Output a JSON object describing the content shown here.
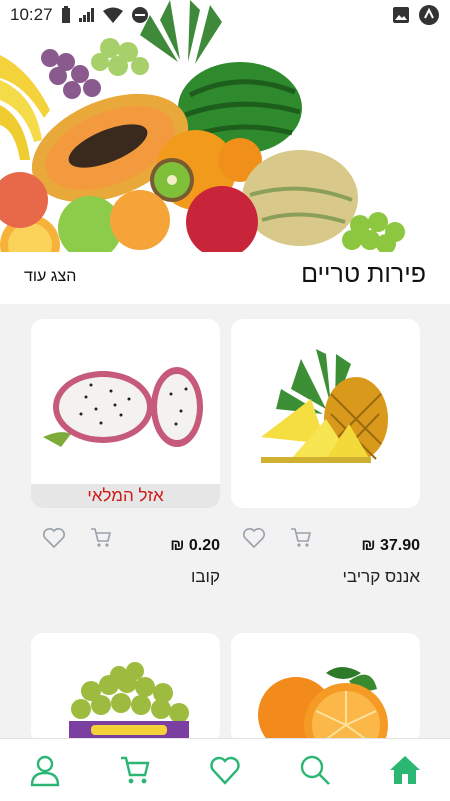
{
  "status_bar": {
    "time": "10:27"
  },
  "section": {
    "title": "פירות טריים",
    "show_more": "הצג עוד"
  },
  "products": [
    {
      "name": "אננס קריבי",
      "price": "37.90 ₪",
      "image": "pineapple",
      "sold_out": ""
    },
    {
      "name": "קובו",
      "price": "0.20 ₪",
      "image": "dragon-fruit",
      "sold_out": "אזל המלאי"
    },
    {
      "name": "",
      "price": "",
      "image": "oranges",
      "sold_out": ""
    },
    {
      "name": "",
      "price": "",
      "image": "grapes-box",
      "sold_out": ""
    }
  ],
  "colors": {
    "accent": "#2bb673",
    "sold_out_text": "#d01818",
    "icon_gray": "#9aa1ab"
  },
  "bottom_nav": [
    "home-icon",
    "search-icon",
    "heart-icon",
    "cart-icon",
    "user-icon"
  ]
}
